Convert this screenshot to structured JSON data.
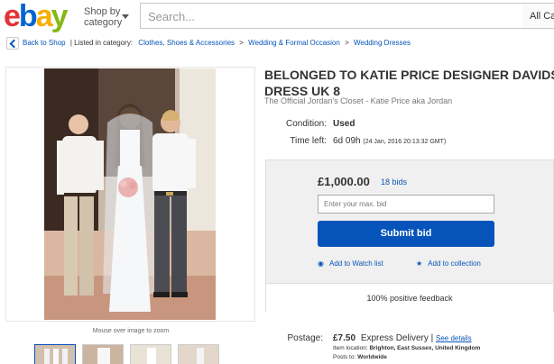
{
  "header": {
    "logo_letters": [
      "e",
      "b",
      "a",
      "y"
    ],
    "logo_colors": [
      "#e53238",
      "#0064d2",
      "#f5af02",
      "#86b817"
    ],
    "shop_by_line1": "Shop by",
    "shop_by_line2": "category",
    "search_placeholder": "Search...",
    "all_categories": "All Cat"
  },
  "breadcrumb": {
    "back": "Back to Shop",
    "listed_in": "| Listed in category:",
    "path": [
      "Clothes, Shoes & Accessories",
      "Wedding & Formal Occasion",
      "Wedding Dresses"
    ],
    "separator": ">"
  },
  "image": {
    "zoom_hint": "Mouse over image to zoom"
  },
  "item": {
    "title_line1": "BELONGED TO KATIE PRICE DESIGNER DAVIDS BRIDAL",
    "title_line2": "DRESS UK 8",
    "subtitle": "The Official Jordan's Closet - Katie Price aka Jordan",
    "condition_label": "Condition:",
    "condition_value": "Used",
    "time_left_label": "Time left:",
    "time_left_value": "6d 09h",
    "time_left_detail": "(24 Jan, 2016   20:13:32 GMT)"
  },
  "bid": {
    "price": "£1,000.00",
    "bids": "18 bids",
    "input_placeholder": "Enter your max. bid",
    "submit": "Submit bid",
    "watch": "Add to Watch list",
    "collection": "Add to collection",
    "feedback": "100% positive feedback"
  },
  "postage": {
    "label": "Postage:",
    "price": "£7.50",
    "method": "Express Delivery",
    "see_details": "See details",
    "location_label": "Item location:",
    "location_value": "Brighton, East Sussex, United Kingdom",
    "posts_to_label": "Posts to:",
    "posts_to_value": "Worldwide"
  }
}
